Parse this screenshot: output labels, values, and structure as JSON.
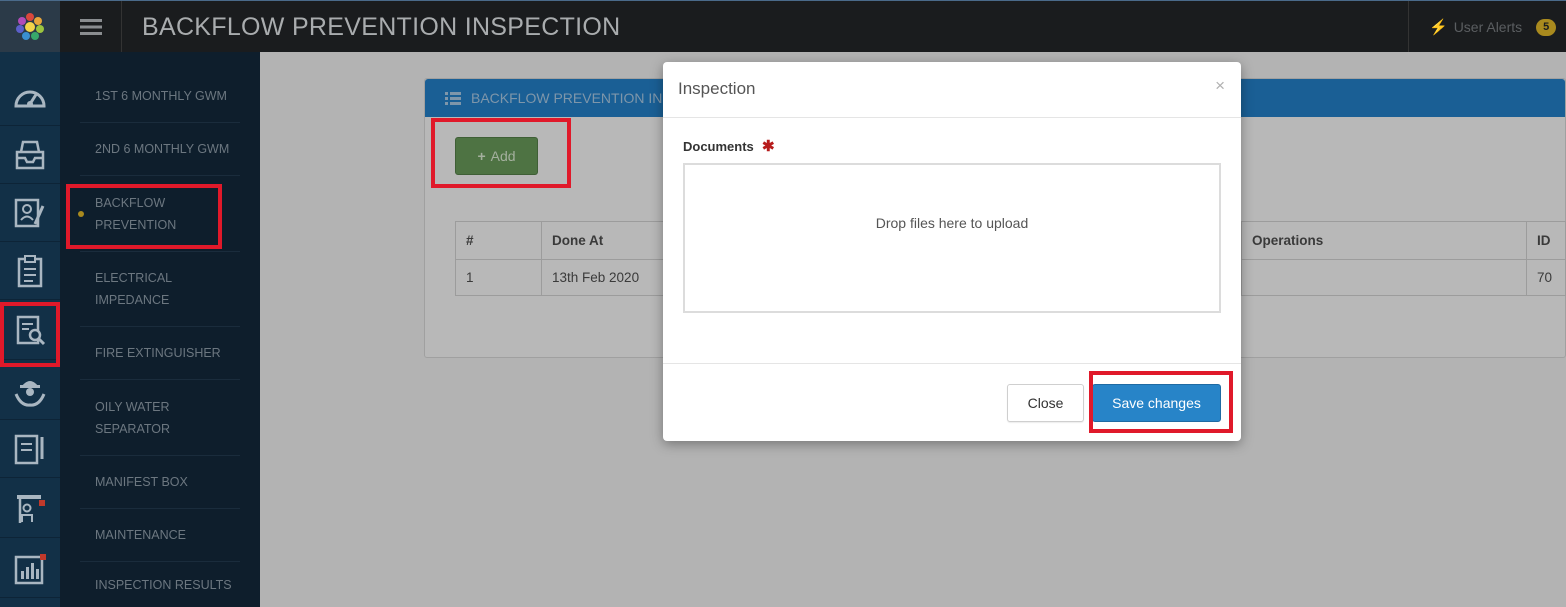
{
  "header": {
    "title": "BACKFLOW PREVENTION INSPECTION",
    "alerts_label": "User Alerts",
    "alerts_count": "5"
  },
  "rail": {
    "icons": [
      "dashboard-icon",
      "inbox-tray-icon",
      "profile-edit-icon",
      "clipboard-checklist-icon",
      "document-search-icon",
      "safety-worker-icon",
      "notebook-pen-icon",
      "training-presenter-icon",
      "bar-chart-icon"
    ]
  },
  "subnav": {
    "items": [
      {
        "label_lines": [
          "1ST 6 MONTHLY GWM"
        ]
      },
      {
        "label_lines": [
          "2ND 6 MONTHLY GWM"
        ]
      },
      {
        "label_lines": [
          "BACKFLOW",
          "PREVENTION"
        ]
      },
      {
        "label_lines": [
          "ELECTRICAL",
          "IMPEDANCE"
        ]
      },
      {
        "label_lines": [
          "FIRE EXTINGUISHER"
        ]
      },
      {
        "label_lines": [
          "OILY WATER",
          "SEPARATOR"
        ]
      },
      {
        "label_lines": [
          "MANIFEST BOX"
        ]
      },
      {
        "label_lines": [
          "MAINTENANCE"
        ]
      },
      {
        "label_lines": [
          "INSPECTION RESULTS"
        ]
      }
    ],
    "active_index": 2
  },
  "panel": {
    "title": "BACKFLOW PREVENTION INSP",
    "add_label": "Add",
    "table": {
      "headers": [
        "#",
        "Done At",
        "Operations",
        "ID"
      ],
      "rows": [
        [
          "1",
          "13th Feb 2020",
          "",
          "70"
        ]
      ]
    }
  },
  "modal": {
    "title": "Inspection",
    "close_x": "×",
    "documents_label": "Documents",
    "required_mark": "✱",
    "dropzone_text": "Drop files here to upload",
    "close_label": "Close",
    "save_label": "Save changes"
  },
  "colors": {
    "highlight": "#e0192a",
    "primary": "#2784c8",
    "add_button": "#4e7343",
    "badge": "#a98a1e"
  }
}
